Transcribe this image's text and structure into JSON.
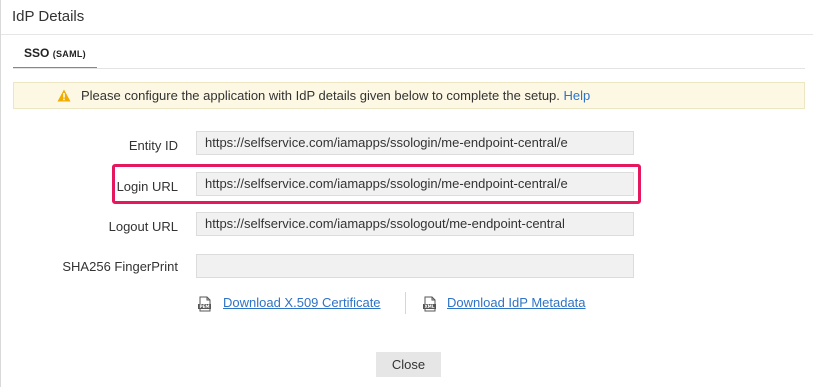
{
  "dialog": {
    "title": "IdP Details"
  },
  "tabs": [
    {
      "label_main": "SSO",
      "label_sub": "(SAML)"
    }
  ],
  "alert": {
    "icon": "warning-icon",
    "message": "Please configure the application with IdP details given below to complete the setup.",
    "help_link": "Help"
  },
  "fields": {
    "entity_id": {
      "label": "Entity ID",
      "value": "https://selfservice.com/iamapps/ssologin/me-endpoint-central/e"
    },
    "login_url": {
      "label": "Login URL",
      "value": "https://selfservice.com/iamapps/ssologin/me-endpoint-central/e"
    },
    "logout_url": {
      "label": "Logout URL",
      "value": "https://selfservice.com/iamapps/ssologout/me-endpoint-central"
    },
    "sha256": {
      "label": "SHA256 FingerPrint",
      "value": ""
    }
  },
  "downloads": {
    "certificate": {
      "label": "Download X.509 Certificate",
      "icon": "pem-file-icon",
      "badge": "PEM"
    },
    "metadata": {
      "label": "Download IdP Metadata",
      "icon": "xml-file-icon",
      "badge": "XML"
    }
  },
  "footer": {
    "close_label": "Close"
  },
  "colors": {
    "accent_tab": "#4caf50",
    "link": "#2f73c6",
    "highlight": "#e5175f",
    "alert_bg": "#fcf8e3",
    "warning": "#f0ad00"
  }
}
